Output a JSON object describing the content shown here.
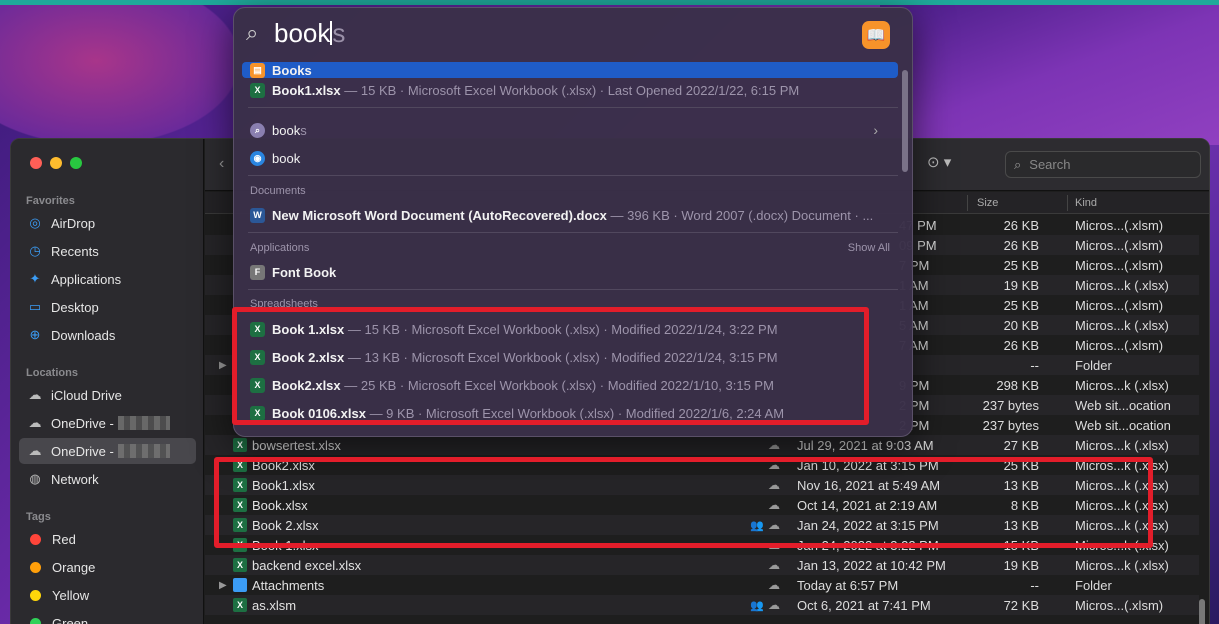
{
  "spotlight": {
    "query_typed": "book",
    "query_completion": "s",
    "top_hit": {
      "title": "Books"
    },
    "top_row": {
      "title": "Book1.xlsx",
      "meta": " — 15 KB · Microsoft Excel Workbook (.xlsx) · Last Opened 2022/1/22, 6:15 PM"
    },
    "suggestions": [
      {
        "typed": "book",
        "rest": "s",
        "icon": "search-icon"
      },
      {
        "typed": "book",
        "rest": "",
        "icon": "safari-icon"
      }
    ],
    "sections": {
      "documents": "Documents",
      "applications": "Applications",
      "show_all": "Show All",
      "spreadsheets": "Spreadsheets"
    },
    "documents": [
      {
        "title": "New Microsoft Word Document (AutoRecovered).docx",
        "meta": " — 396 KB · Word 2007 (.docx) Document · ..."
      }
    ],
    "applications": [
      {
        "title": "Font Book"
      }
    ],
    "spreadsheets": [
      {
        "title": "Book 1.xlsx",
        "meta": " — 15 KB · Microsoft Excel Workbook (.xlsx) · Modified 2022/1/24, 3:22 PM"
      },
      {
        "title": "Book 2.xlsx",
        "meta": " — 13 KB · Microsoft Excel Workbook (.xlsx) · Modified 2022/1/24, 3:15 PM"
      },
      {
        "title": "Book2.xlsx",
        "meta": " — 25 KB · Microsoft Excel Workbook (.xlsx) · Modified 2022/1/10, 3:15 PM"
      },
      {
        "title": "Book 0106.xlsx",
        "meta": " — 9 KB · Microsoft Excel Workbook (.xlsx) · Modified 2022/1/6, 2:24 AM"
      }
    ]
  },
  "finder": {
    "sidebar": {
      "favorites_label": "Favorites",
      "favorites": [
        "AirDrop",
        "Recents",
        "Applications",
        "Desktop",
        "Downloads"
      ],
      "locations_label": "Locations",
      "locations": [
        "iCloud Drive",
        "OneDrive -",
        "OneDrive -",
        "Network"
      ],
      "tags_label": "Tags",
      "tags": [
        {
          "name": "Red",
          "color": "#ff453a"
        },
        {
          "name": "Orange",
          "color": "#ff9f0a"
        },
        {
          "name": "Yellow",
          "color": "#ffd60a"
        },
        {
          "name": "Green",
          "color": "#30d158"
        }
      ]
    },
    "search_placeholder": "Search",
    "columns": {
      "size": "Size",
      "kind": "Kind"
    },
    "partial_rows": [
      {
        "date_tail": "47 PM",
        "size": "26 KB",
        "kind": "Micros...(.xlsm)"
      },
      {
        "date_tail": "09 PM",
        "size": "26 KB",
        "kind": "Micros...(.xlsm)"
      },
      {
        "date_tail": "7 PM",
        "size": "25 KB",
        "kind": "Micros...(.xlsm)"
      },
      {
        "date_tail": "1 AM",
        "size": "19 KB",
        "kind": "Micros...k (.xlsx)"
      },
      {
        "date_tail": "1 AM",
        "size": "25 KB",
        "kind": "Micros...(.xlsm)"
      },
      {
        "date_tail": "5 AM",
        "size": "20 KB",
        "kind": "Micros...k (.xlsx)"
      },
      {
        "date_tail": "7 AM",
        "size": "26 KB",
        "kind": "Micros...(.xlsm)"
      },
      {
        "date_tail": "",
        "size": "--",
        "kind": "Folder"
      },
      {
        "date_tail": "9 PM",
        "size": "298 KB",
        "kind": "Micros...k (.xlsx)"
      },
      {
        "date_tail": "2 PM",
        "size": "237 bytes",
        "kind": "Web sit...ocation"
      },
      {
        "date_tail": "2 PM",
        "size": "237 bytes",
        "kind": "Web sit...ocation"
      }
    ],
    "rows": [
      {
        "name": "bowsertest.xlsx",
        "date": "Jul 29, 2021 at 9:03 AM",
        "size": "27 KB",
        "kind": "Micros...k (.xlsx)",
        "shared": false
      },
      {
        "name": "Book2.xlsx",
        "date": "Jan 10, 2022 at 3:15 PM",
        "size": "25 KB",
        "kind": "Micros...k (.xlsx)",
        "shared": false
      },
      {
        "name": "Book1.xlsx",
        "date": "Nov 16, 2021 at 5:49 AM",
        "size": "13 KB",
        "kind": "Micros...k (.xlsx)",
        "shared": false
      },
      {
        "name": "Book.xlsx",
        "date": "Oct 14, 2021 at 2:19 AM",
        "size": "8 KB",
        "kind": "Micros...k (.xlsx)",
        "shared": false
      },
      {
        "name": "Book 2.xlsx",
        "date": "Jan 24, 2022 at 3:15 PM",
        "size": "13 KB",
        "kind": "Micros...k (.xlsx)",
        "shared": true
      },
      {
        "name": "Book 1.xlsx",
        "date": "Jan 24, 2022 at 3:22 PM",
        "size": "15 KB",
        "kind": "Micros...k (.xlsx)",
        "shared": false
      },
      {
        "name": "backend excel.xlsx",
        "date": "Jan 13, 2022 at 10:42 PM",
        "size": "19 KB",
        "kind": "Micros...k (.xlsx)",
        "shared": false
      },
      {
        "name": "Attachments",
        "date": "Today at 6:57 PM",
        "size": "--",
        "kind": "Folder",
        "shared": false,
        "folder": true
      },
      {
        "name": "as.xlsm",
        "date": "Oct 6, 2021 at 7:41 PM",
        "size": "72 KB",
        "kind": "Micros...(.xlsm)",
        "shared": true
      }
    ]
  }
}
